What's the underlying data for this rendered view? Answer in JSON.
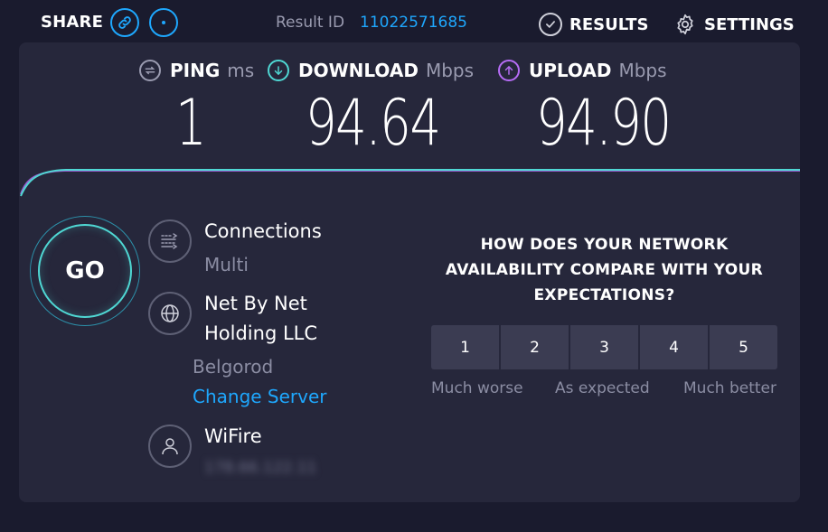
{
  "header": {
    "share_label": "SHARE",
    "result_label": "Result ID",
    "result_id": "11022571685",
    "results_label": "RESULTS",
    "settings_label": "SETTINGS"
  },
  "metrics": {
    "ping": {
      "name": "PING",
      "unit": "ms",
      "value": "1"
    },
    "download": {
      "name": "DOWNLOAD",
      "unit": "Mbps",
      "value": "94.64"
    },
    "upload": {
      "name": "UPLOAD",
      "unit": "Mbps",
      "value": "94.90"
    }
  },
  "go_label": "GO",
  "server": {
    "connections_title": "Connections",
    "connections_value": "Multi",
    "host_name": "Net By Net Holding LLC",
    "host_location": "Belgorod",
    "change_server_label": "Change Server",
    "isp_name": "WiFire",
    "isp_ip": "178.66.122.11"
  },
  "survey": {
    "question": "HOW DOES YOUR NETWORK AVAILABILITY COMPARE WITH YOUR EXPECTATIONS?",
    "options": [
      "1",
      "2",
      "3",
      "4",
      "5"
    ],
    "low_label": "Much worse",
    "mid_label": "As expected",
    "high_label": "Much better"
  },
  "colors": {
    "background": "#1a1b2e",
    "panel": "#26273b",
    "accent_blue": "#1ea7fd",
    "download_teal": "#4fd7d3",
    "upload_purple": "#b56cf5",
    "muted_text": "#8b8da3"
  },
  "icons": {
    "share_link": "link-icon",
    "share_more": "more-dots-icon",
    "results": "check-circle-icon",
    "settings": "gear-icon",
    "ping": "ping-arrows-icon",
    "download": "arrow-down-icon",
    "upload": "arrow-up-icon",
    "connections": "connections-icon",
    "host": "globe-icon",
    "isp": "user-icon"
  }
}
